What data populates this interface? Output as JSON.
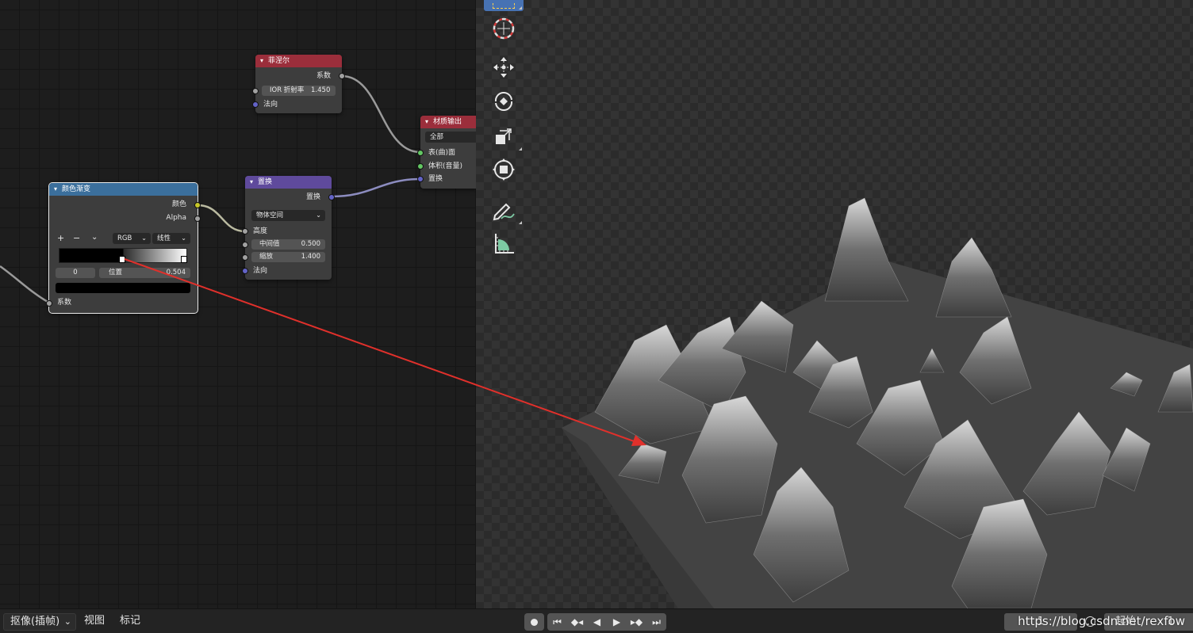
{
  "nodes": {
    "fresnel": {
      "title": "菲涅尔",
      "out_factor": "系数",
      "ior_label": "IOR 折射率",
      "ior_value": "1.450",
      "in_normal": "法向"
    },
    "material_output": {
      "title": "材质输出",
      "target": "全部",
      "in_surface": "表(曲)面",
      "in_volume": "体积(音量)",
      "in_displacement": "置换"
    },
    "displacement": {
      "title": "置换",
      "out_displacement": "置换",
      "space": "物体空间",
      "in_height": "高度",
      "midlevel_label": "中间值",
      "midlevel_value": "0.500",
      "scale_label": "缩放",
      "scale_value": "1.400",
      "in_normal": "法向"
    },
    "color_ramp": {
      "title": "颜色渐变",
      "out_color": "颜色",
      "out_alpha": "Alpha",
      "add": "+",
      "remove": "−",
      "more": "⌄",
      "color_mode": "RGB",
      "interpolation": "线性",
      "stop_index": "0",
      "position_label": "位置",
      "position_value": "0.504",
      "in_factor": "系数",
      "stop_color": "#000000"
    }
  },
  "toolbar": {
    "tools": [
      "select-box-icon",
      "cursor-icon",
      "move-icon",
      "rotate-icon",
      "scale-icon",
      "transform-icon",
      "annotate-icon",
      "measure-icon"
    ]
  },
  "timeline": {
    "mode": "抠像(插帧)",
    "view": "视图",
    "marker": "标记",
    "current_frame": "1",
    "start_label": "起始",
    "start_value": "1"
  },
  "watermark": "https://blog.csdn.net/rexfow",
  "colors": {
    "fresnel_header": "#9b2e3b",
    "output_header": "#9b2e3b",
    "ramp_header": "#3b6f9c",
    "displacement_header": "#5f4a9c",
    "annotation_arrow": "#e0302b",
    "active_tool": "#4772b3"
  }
}
